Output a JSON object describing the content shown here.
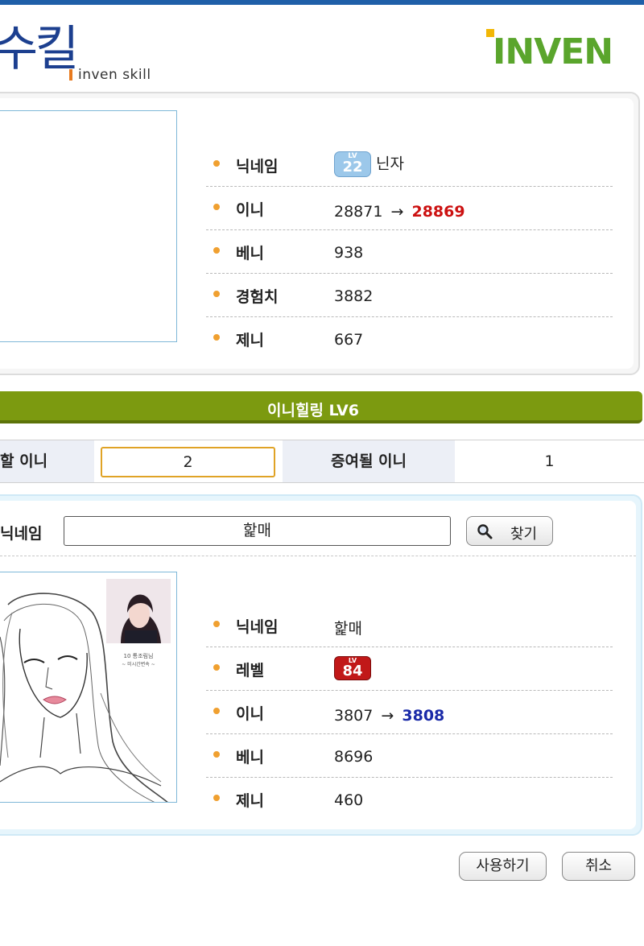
{
  "header": {
    "logo_korean": "수킬",
    "logo_subtitle": "inven skill",
    "brand": "INVEN",
    "brand_color": "#5aa52c"
  },
  "sender": {
    "rows": [
      {
        "label": "닉네임",
        "value": "닌자",
        "badge_level": "22",
        "badge_lv": "LV"
      },
      {
        "label": "이니",
        "value_from": "28871",
        "arrow": "→",
        "value_to": "28869"
      },
      {
        "label": "베니",
        "value": "938"
      },
      {
        "label": "경험치",
        "value": "3882"
      },
      {
        "label": "제니",
        "value": "667"
      }
    ]
  },
  "skill": {
    "title": "이니힐링 LV6"
  },
  "amount": {
    "label": "할 이니",
    "input_value": "2",
    "given_label": "증여될 이니",
    "given_value": "1"
  },
  "search": {
    "label": "닉네임",
    "input_value": "핥매",
    "button_label": "찾기"
  },
  "receiver": {
    "photo_caption_1": "10 통조림님",
    "photo_caption_2": "~ 미시간변속 ~",
    "rows": [
      {
        "label": "닉네임",
        "value": "핥매"
      },
      {
        "label": "레벨",
        "badge_level": "84",
        "badge_lv": "LV"
      },
      {
        "label": "이니",
        "value_from": "3807",
        "arrow": "→",
        "value_to": "3808"
      },
      {
        "label": "베니",
        "value": "8696"
      },
      {
        "label": "제니",
        "value": "460"
      }
    ]
  },
  "actions": {
    "use_label": "사용하기",
    "cancel_label": "취소"
  },
  "colors": {
    "decrease": "#cc1111",
    "increase": "#1a2aa8",
    "skill_bar": "#7c9a10",
    "bullet": "#f0a030"
  }
}
